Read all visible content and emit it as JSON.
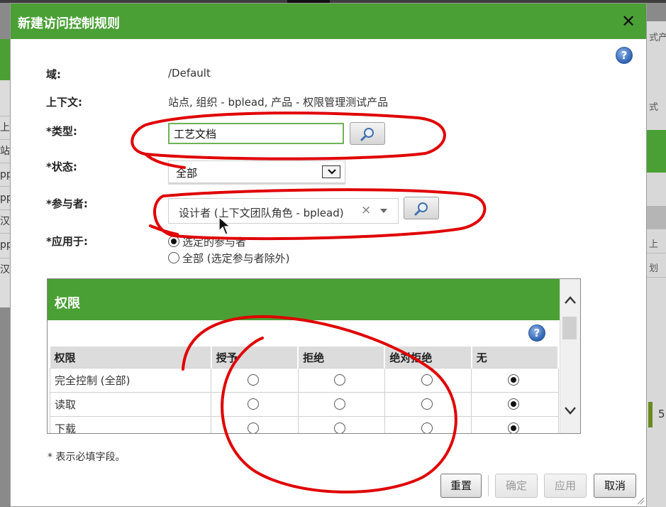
{
  "background": {
    "left_rows": [
      "上下",
      "站",
      "pp",
      "pp",
      "汉",
      "pp",
      "汉"
    ],
    "right_texts": [
      "式产",
      "式",
      "上",
      "划"
    ],
    "right_number": "5"
  },
  "dialog": {
    "title": "新建访问控制规则",
    "close_label": "✕",
    "help_label": "?"
  },
  "form": {
    "domain": {
      "label": "域:",
      "value": "/Default"
    },
    "context": {
      "label": "上下文:",
      "value": "站点, 组织 - bplead, 产品 - 权限管理测试产品"
    },
    "type": {
      "label": "*类型:",
      "value": "工艺文档"
    },
    "status": {
      "label": "*状态:",
      "value": "全部"
    },
    "participant": {
      "label": "*参与者:",
      "value": "设计者 (上下文团队角色 - bplead)",
      "clear": "×"
    },
    "apply_to": {
      "label": "*应用于:",
      "options": [
        "选定的参与者",
        "全部 (选定参与者除外)"
      ],
      "selected": 0
    }
  },
  "permissions": {
    "title": "权限",
    "columns": [
      "权限",
      "授予",
      "拒绝",
      "绝对拒绝",
      "无"
    ],
    "rows": [
      {
        "name": "完全控制 (全部)",
        "selected": 3
      },
      {
        "name": "读取",
        "selected": 3
      },
      {
        "name": "下载",
        "selected": 3
      }
    ]
  },
  "required_note": "* 表示必填字段。",
  "buttons": {
    "reset": "重置",
    "ok": "确定",
    "apply": "应用",
    "cancel": "取消"
  },
  "colors": {
    "header_green": "#4aa035",
    "annotation_red": "#e00000"
  }
}
